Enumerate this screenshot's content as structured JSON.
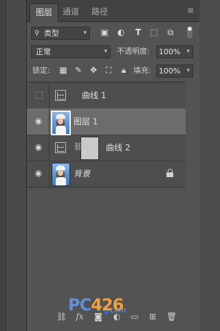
{
  "tabs": [
    {
      "label": "图层",
      "active": true
    },
    {
      "label": "通道",
      "active": false
    },
    {
      "label": "路径",
      "active": false
    }
  ],
  "panel_menu_icon": "menu-icon",
  "filter": {
    "kind_label": "类型",
    "search_icon": "magnifier-icon",
    "icons": [
      "pixel-filter-icon",
      "adjustment-filter-icon",
      "type-filter-icon",
      "shape-filter-icon",
      "smart-object-filter-icon"
    ]
  },
  "blend": {
    "mode": "正常",
    "opacity_label": "不透明度:",
    "opacity_value": "100%",
    "fill_label": "填充:",
    "fill_value": "100%"
  },
  "lock": {
    "label": "锁定:",
    "icons": [
      "lock-transparent-icon",
      "lock-pixels-icon",
      "lock-position-icon",
      "lock-artboard-icon",
      "lock-all-icon"
    ]
  },
  "layers": [
    {
      "name": "曲线 1",
      "visible": false,
      "type": "adjustment"
    },
    {
      "name": "图层 1",
      "visible": true,
      "type": "image",
      "selected": true
    },
    {
      "name": "曲线 2",
      "visible": true,
      "type": "adjustment-mask"
    },
    {
      "name": "背景",
      "visible": true,
      "type": "background",
      "locked": true
    }
  ],
  "bottom_icons": [
    "link-layers-icon",
    "fx-icon",
    "add-mask-icon",
    "new-fill-adjustment-icon",
    "new-group-icon",
    "new-layer-icon",
    "delete-icon"
  ],
  "watermark": {
    "brand": "PC",
    "digits": "426",
    "suffix": "com"
  },
  "colors": {
    "selected_row": "#6c6c6c",
    "panel_bg": "#535353"
  }
}
